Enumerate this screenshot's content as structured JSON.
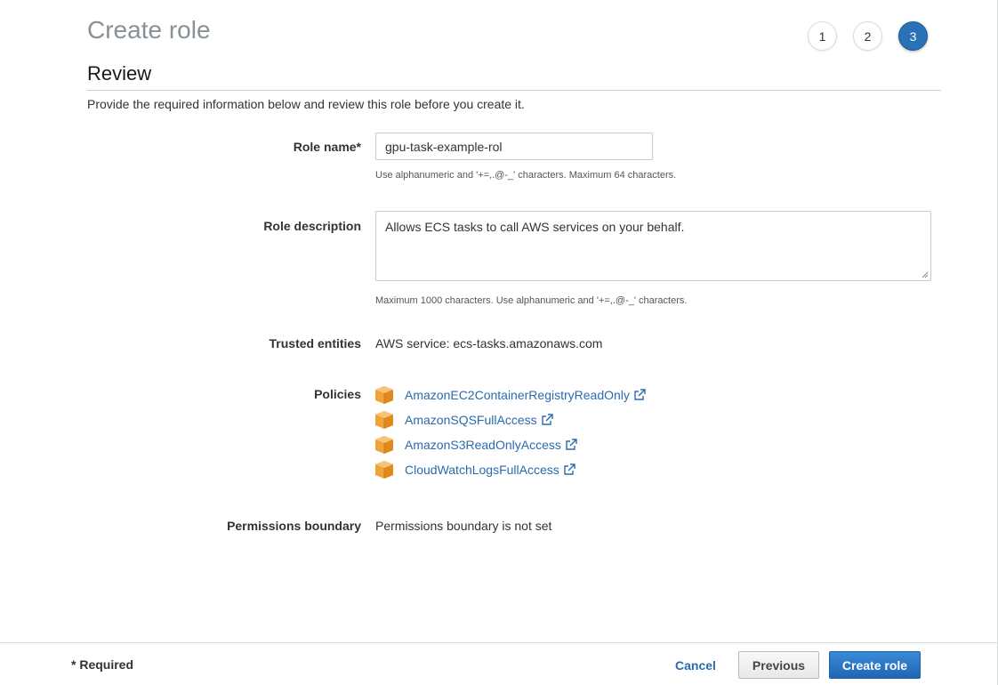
{
  "page": {
    "title": "Create role"
  },
  "steps": [
    "1",
    "2",
    "3"
  ],
  "active_step": "3",
  "section": {
    "title": "Review",
    "intro": "Provide the required information below and review this role before you create it."
  },
  "form": {
    "role_name": {
      "label": "Role name*",
      "value": "gpu-task-example-rol",
      "hint": "Use alphanumeric and '+=,.@-_' characters. Maximum 64 characters."
    },
    "role_description": {
      "label": "Role description",
      "value": "Allows ECS tasks to call AWS services on your behalf.",
      "hint": "Maximum 1000 characters. Use alphanumeric and '+=,.@-_' characters."
    },
    "trusted_entities": {
      "label": "Trusted entities",
      "value": "AWS service: ecs-tasks.amazonaws.com"
    },
    "policies": {
      "label": "Policies",
      "items": [
        "AmazonEC2ContainerRegistryReadOnly",
        "AmazonSQSFullAccess",
        "AmazonS3ReadOnlyAccess",
        "CloudWatchLogsFullAccess"
      ]
    },
    "permissions_boundary": {
      "label": "Permissions boundary",
      "value": "Permissions boundary is not set"
    }
  },
  "footer": {
    "required_note": "* Required",
    "cancel_label": "Cancel",
    "previous_label": "Previous",
    "create_label": "Create role"
  },
  "colors": {
    "accent": "#2a71b8",
    "link": "#2a6ab0",
    "policy_icon": "#f0a33a"
  },
  "icons": {
    "policy": "policy-box-icon",
    "external": "external-link-icon"
  }
}
